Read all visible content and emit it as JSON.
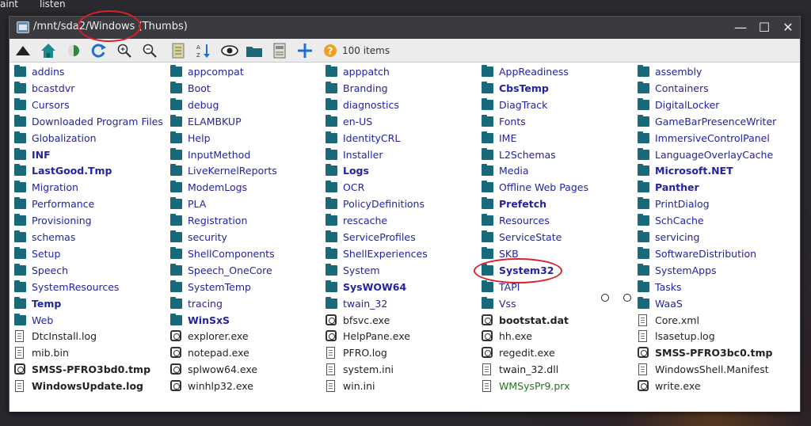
{
  "topbar": {
    "left_text": "aint",
    "right_text": "listen"
  },
  "window": {
    "title": "/mnt/sda2/Windows (Thumbs)",
    "minimize": "—",
    "maximize": "☐",
    "close": "✕"
  },
  "toolbar": {
    "items_count": "100 items",
    "buttons": [
      "up-icon",
      "home-icon",
      "back-icon",
      "refresh-icon",
      "zoom-in-icon",
      "zoom-out-icon",
      "notes-icon",
      "sort-icon",
      "eye-icon",
      "folder-icon",
      "document-icon",
      "new-icon",
      "help-icon"
    ]
  },
  "columns": [
    [
      {
        "label": "addins",
        "kind": "folder"
      },
      {
        "label": "bcastdvr",
        "kind": "folder"
      },
      {
        "label": "Cursors",
        "kind": "folder"
      },
      {
        "label": "Downloaded Program Files",
        "kind": "folder"
      },
      {
        "label": "Globalization",
        "kind": "folder"
      },
      {
        "label": "INF",
        "kind": "folder",
        "bold": true
      },
      {
        "label": "LastGood.Tmp",
        "kind": "folder",
        "bold": true
      },
      {
        "label": "Migration",
        "kind": "folder"
      },
      {
        "label": "Performance",
        "kind": "folder"
      },
      {
        "label": "Provisioning",
        "kind": "folder"
      },
      {
        "label": "schemas",
        "kind": "folder"
      },
      {
        "label": "Setup",
        "kind": "folder"
      },
      {
        "label": "Speech",
        "kind": "folder"
      },
      {
        "label": "SystemResources",
        "kind": "folder"
      },
      {
        "label": "Temp",
        "kind": "folder",
        "bold": true
      },
      {
        "label": "Web",
        "kind": "folder"
      },
      {
        "label": "DtcInstall.log",
        "kind": "doc"
      },
      {
        "label": "mib.bin",
        "kind": "doc"
      },
      {
        "label": "SMSS-PFRO3bd0.tmp",
        "kind": "exe",
        "bold": true
      },
      {
        "label": "WindowsUpdate.log",
        "kind": "doc",
        "bold": true
      }
    ],
    [
      {
        "label": "appcompat",
        "kind": "folder"
      },
      {
        "label": "Boot",
        "kind": "folder"
      },
      {
        "label": "debug",
        "kind": "folder"
      },
      {
        "label": "ELAMBKUP",
        "kind": "folder"
      },
      {
        "label": "Help",
        "kind": "folder"
      },
      {
        "label": "InputMethod",
        "kind": "folder"
      },
      {
        "label": "LiveKernelReports",
        "kind": "folder"
      },
      {
        "label": "ModemLogs",
        "kind": "folder"
      },
      {
        "label": "PLA",
        "kind": "folder"
      },
      {
        "label": "Registration",
        "kind": "folder"
      },
      {
        "label": "security",
        "kind": "folder"
      },
      {
        "label": "ShellComponents",
        "kind": "folder"
      },
      {
        "label": "Speech_OneCore",
        "kind": "folder"
      },
      {
        "label": "SystemTemp",
        "kind": "folder"
      },
      {
        "label": "tracing",
        "kind": "folder"
      },
      {
        "label": "WinSxS",
        "kind": "folder",
        "bold": true
      },
      {
        "label": "explorer.exe",
        "kind": "exe"
      },
      {
        "label": "notepad.exe",
        "kind": "exe"
      },
      {
        "label": "splwow64.exe",
        "kind": "exe"
      },
      {
        "label": "winhlp32.exe",
        "kind": "exe"
      }
    ],
    [
      {
        "label": "apppatch",
        "kind": "folder"
      },
      {
        "label": "Branding",
        "kind": "folder"
      },
      {
        "label": "diagnostics",
        "kind": "folder"
      },
      {
        "label": "en-US",
        "kind": "folder"
      },
      {
        "label": "IdentityCRL",
        "kind": "folder"
      },
      {
        "label": "Installer",
        "kind": "folder"
      },
      {
        "label": "Logs",
        "kind": "folder",
        "bold": true
      },
      {
        "label": "OCR",
        "kind": "folder"
      },
      {
        "label": "PolicyDefinitions",
        "kind": "folder"
      },
      {
        "label": "rescache",
        "kind": "folder"
      },
      {
        "label": "ServiceProfiles",
        "kind": "folder"
      },
      {
        "label": "ShellExperiences",
        "kind": "folder"
      },
      {
        "label": "System",
        "kind": "folder"
      },
      {
        "label": "SysWOW64",
        "kind": "folder",
        "bold": true
      },
      {
        "label": "twain_32",
        "kind": "folder"
      },
      {
        "label": "bfsvc.exe",
        "kind": "exe"
      },
      {
        "label": "HelpPane.exe",
        "kind": "exe"
      },
      {
        "label": "PFRO.log",
        "kind": "doc"
      },
      {
        "label": "system.ini",
        "kind": "doc"
      },
      {
        "label": "win.ini",
        "kind": "doc"
      }
    ],
    [
      {
        "label": "AppReadiness",
        "kind": "folder"
      },
      {
        "label": "CbsTemp",
        "kind": "folder",
        "bold": true
      },
      {
        "label": "DiagTrack",
        "kind": "folder"
      },
      {
        "label": "Fonts",
        "kind": "folder"
      },
      {
        "label": "IME",
        "kind": "folder"
      },
      {
        "label": "L2Schemas",
        "kind": "folder"
      },
      {
        "label": "Media",
        "kind": "folder"
      },
      {
        "label": "Offline Web Pages",
        "kind": "folder"
      },
      {
        "label": "Prefetch",
        "kind": "folder",
        "bold": true
      },
      {
        "label": "Resources",
        "kind": "folder"
      },
      {
        "label": "ServiceState",
        "kind": "folder"
      },
      {
        "label": "SKB",
        "kind": "folder"
      },
      {
        "label": "System32",
        "kind": "folder",
        "bold": true
      },
      {
        "label": "TAPI",
        "kind": "folder"
      },
      {
        "label": "Vss",
        "kind": "folder"
      },
      {
        "label": "bootstat.dat",
        "kind": "exe",
        "bold": true,
        "green": true
      },
      {
        "label": "hh.exe",
        "kind": "exe"
      },
      {
        "label": "regedit.exe",
        "kind": "exe"
      },
      {
        "label": "twain_32.dll",
        "kind": "doc"
      },
      {
        "label": "WMSysPr9.prx",
        "kind": "doc",
        "green": true
      }
    ],
    [
      {
        "label": "assembly",
        "kind": "folder"
      },
      {
        "label": "Containers",
        "kind": "folder"
      },
      {
        "label": "DigitalLocker",
        "kind": "folder"
      },
      {
        "label": "GameBarPresenceWriter",
        "kind": "folder"
      },
      {
        "label": "ImmersiveControlPanel",
        "kind": "folder"
      },
      {
        "label": "LanguageOverlayCache",
        "kind": "folder"
      },
      {
        "label": "Microsoft.NET",
        "kind": "folder",
        "bold": true
      },
      {
        "label": "Panther",
        "kind": "folder",
        "bold": true
      },
      {
        "label": "PrintDialog",
        "kind": "folder"
      },
      {
        "label": "SchCache",
        "kind": "folder"
      },
      {
        "label": "servicing",
        "kind": "folder"
      },
      {
        "label": "SoftwareDistribution",
        "kind": "folder"
      },
      {
        "label": "SystemApps",
        "kind": "folder"
      },
      {
        "label": "Tasks",
        "kind": "folder"
      },
      {
        "label": "WaaS",
        "kind": "folder"
      },
      {
        "label": "Core.xml",
        "kind": "doc"
      },
      {
        "label": "lsasetup.log",
        "kind": "doc"
      },
      {
        "label": "SMSS-PFRO3bc0.tmp",
        "kind": "exe",
        "bold": true
      },
      {
        "label": "WindowsShell.Manifest",
        "kind": "doc"
      },
      {
        "label": "write.exe",
        "kind": "exe"
      }
    ]
  ]
}
